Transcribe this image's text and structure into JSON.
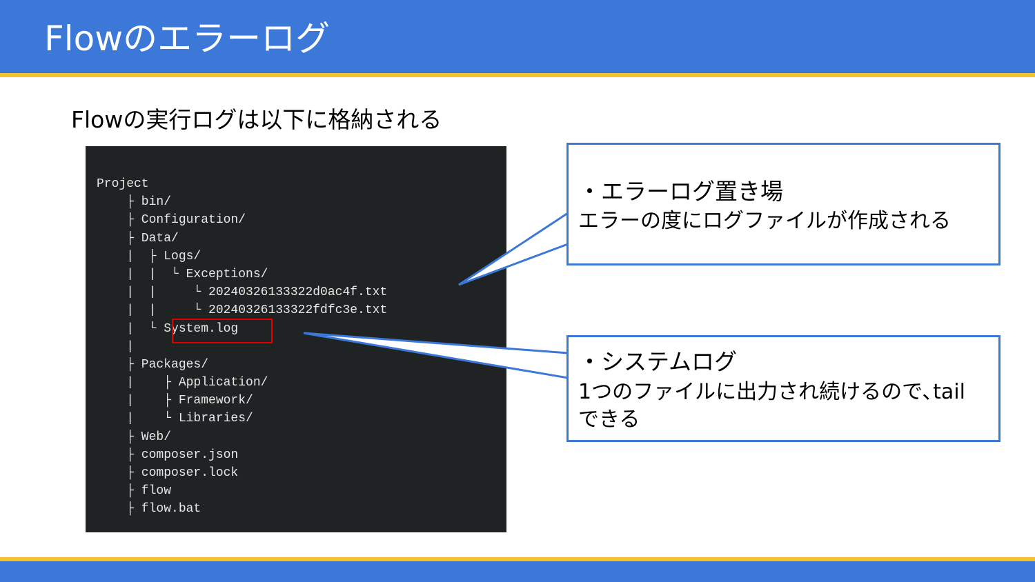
{
  "slide": {
    "title": "Flowのエラーログ",
    "subtitle": "Flowの実行ログは以下に格納される"
  },
  "tree": {
    "lines": [
      "Project",
      "    ├ bin/",
      "    ├ Configuration/",
      "    ├ Data/",
      "    |  ├ Logs/",
      "    |  |  └ Exceptions/",
      "    |  |     └ 20240326133322d0ac4f.txt",
      "    |  |     └ 20240326133322fdfc3e.txt",
      "    |  └ System.log",
      "    |",
      "    ├ Packages/",
      "    |    ├ Application/",
      "    |    ├ Framework/",
      "    |    └ Libraries/",
      "    ├ Web/",
      "    ├ composer.json",
      "    ├ composer.lock",
      "    ├ flow",
      "    ├ flow.bat"
    ]
  },
  "callouts": [
    {
      "heading": "・エラーログ置き場",
      "body": "エラーの度にログファイルが作成される"
    },
    {
      "heading": "・システムログ",
      "body": "1つのファイルに出力され続けるので､tailできる"
    }
  ],
  "colors": {
    "header_blue": "#3c78d8",
    "accent_yellow": "#f1c232",
    "terminal_bg": "#202324",
    "highlight_red": "#e00000"
  }
}
